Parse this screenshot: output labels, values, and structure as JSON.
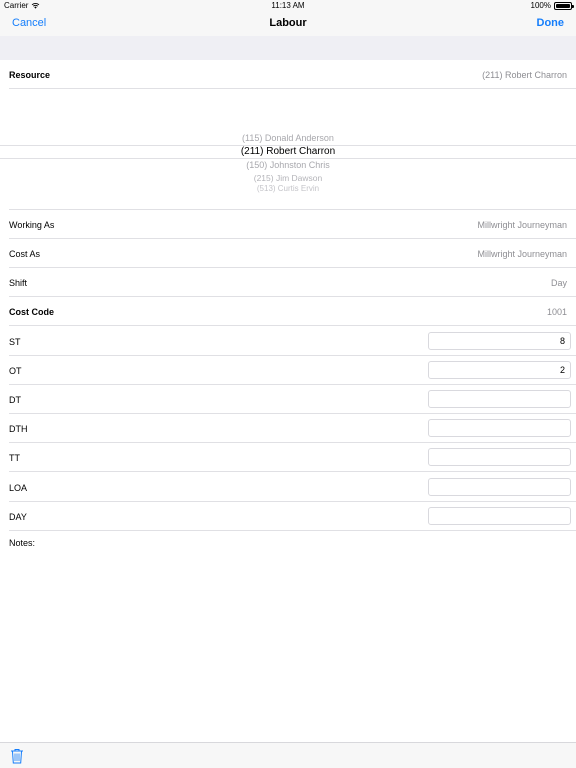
{
  "status_bar": {
    "carrier": "Carrier",
    "time": "11:13 AM",
    "battery": "100%"
  },
  "nav": {
    "cancel_label": "Cancel",
    "title": "Labour",
    "done_label": "Done"
  },
  "resource": {
    "label": "Resource",
    "value": "(211) Robert Charron"
  },
  "picker": {
    "items": [
      "(115) Donald Anderson",
      "(211) Robert Charron",
      "(150) Johnston Chris",
      "(215) Jim Dawson",
      "(513) Curtis Ervin"
    ],
    "selected_index": 1
  },
  "details": {
    "working_as": {
      "label": "Working As",
      "value": "Millwright Journeyman"
    },
    "cost_as": {
      "label": "Cost As",
      "value": "Millwright Journeyman"
    },
    "shift": {
      "label": "Shift",
      "value": "Day"
    },
    "cost_code": {
      "label": "Cost Code",
      "value": "1001"
    }
  },
  "hours": {
    "st": {
      "label": "ST",
      "value": "8"
    },
    "ot": {
      "label": "OT",
      "value": "2"
    },
    "dt": {
      "label": "DT",
      "value": ""
    },
    "dth": {
      "label": "DTH",
      "value": ""
    },
    "tt": {
      "label": "TT",
      "value": ""
    },
    "loa": {
      "label": "LOA",
      "value": ""
    },
    "day": {
      "label": "DAY",
      "value": ""
    }
  },
  "notes": {
    "label": "Notes:"
  },
  "colors": {
    "accent": "#157efb",
    "secondary_text": "#8e8e93",
    "background_gray": "#efeff4"
  },
  "icons": {
    "status_wifi": "wifi-icon",
    "status_battery": "battery-icon",
    "toolbar_delete": "trash-icon"
  }
}
